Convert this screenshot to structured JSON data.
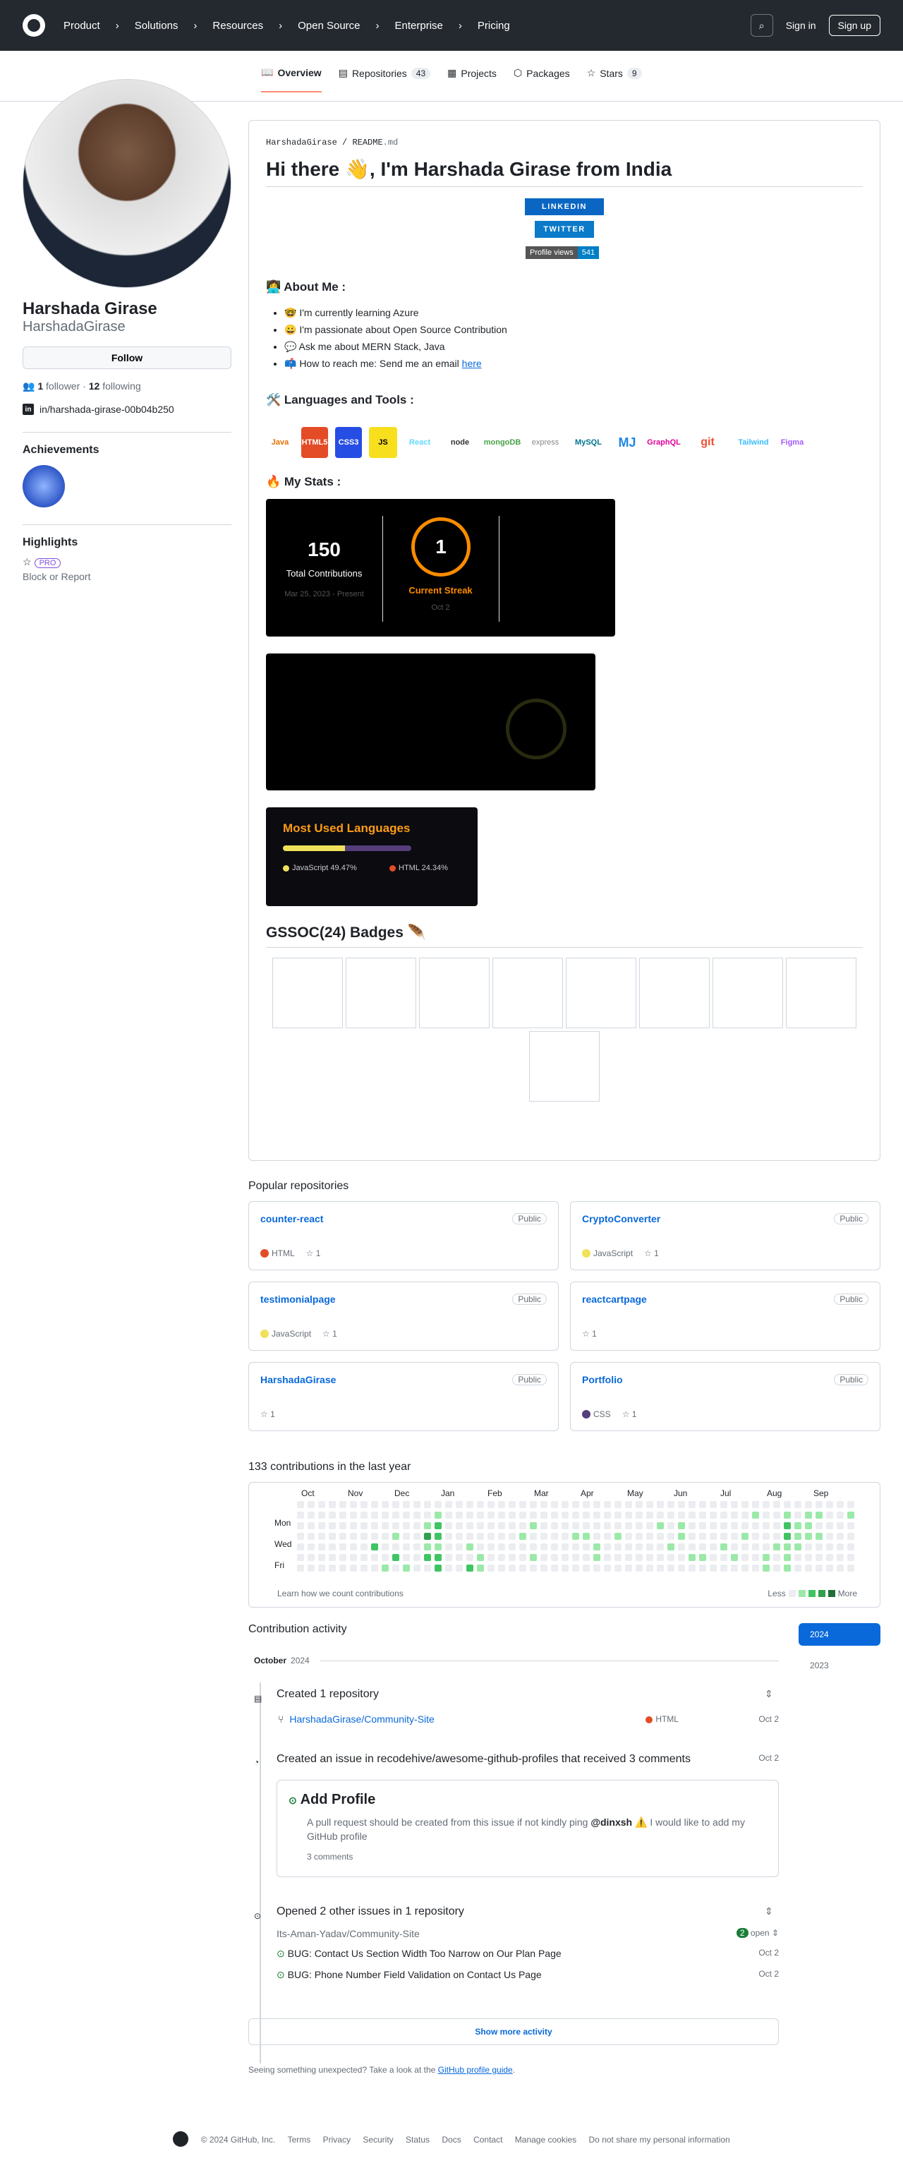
{
  "header": {
    "nav": [
      "Product",
      "Solutions",
      "Resources",
      "Open Source",
      "Enterprise",
      "Pricing"
    ],
    "sign_in": "Sign in",
    "sign_up": "Sign up"
  },
  "tabs": [
    {
      "label": "Overview"
    },
    {
      "label": "Repositories",
      "count": "43"
    },
    {
      "label": "Projects"
    },
    {
      "label": "Packages"
    },
    {
      "label": "Stars",
      "count": "9"
    }
  ],
  "profile": {
    "name": "Harshada Girase",
    "login": "HarshadaGirase",
    "follow": "Follow",
    "followers": "1",
    "followers_label": "follower",
    "following": "12",
    "following_label": "following",
    "linkedin": "in/harshada-girase-00b04b250",
    "achievements_title": "Achievements",
    "highlights_title": "Highlights",
    "pro": "PRO",
    "block": "Block or Report"
  },
  "readme": {
    "crumb_user": "HarshadaGirase",
    "crumb_file": "README",
    "crumb_ext": ".md",
    "title": "Hi there 👋, I'm Harshada Girase from India",
    "linkedin_badge": "LINKEDIN",
    "twitter_badge": "TWITTER",
    "views_label": "Profile views",
    "views": "541",
    "about_title": "👩‍💻 About Me :",
    "about": [
      "🤓 I'm currently learning Azure",
      "😀 I'm passionate about Open Source Contribution",
      "💬 Ask me about MERN Stack, Java",
      "📫 How to reach me: Send me an email "
    ],
    "here": "here",
    "tools_title": "🛠️ Languages and Tools :",
    "tools": [
      "Java",
      "HTML5",
      "CSS3",
      "JS",
      "React",
      "node",
      "mongoDB",
      "express",
      "MySQL",
      "MJ",
      "GraphQL",
      "git",
      "Tailwind",
      "Figma"
    ],
    "stats_title": "🔥 My Stats :",
    "streak": {
      "total": "150",
      "total_label": "Total Contributions",
      "total_range": "Mar 25, 2023 - Present",
      "current": "1",
      "current_label": "Current Streak",
      "current_date": "Oct 2"
    },
    "langs_title": "Most Used Languages",
    "langs": [
      {
        "name": "JavaScript",
        "pct": "49.47%",
        "color": "#f1e05a",
        "v": 49.47
      },
      {
        "name": "HTML",
        "pct": "24.34%",
        "color": "#e34c26",
        "v": 24.34
      }
    ],
    "gssoc_title": "GSSOC(24) Badges 🪶"
  },
  "popular": {
    "title": "Popular repositories",
    "public": "Public",
    "repos": [
      {
        "name": "counter-react",
        "lang": "HTML",
        "color": "#e34c26",
        "stars": "1"
      },
      {
        "name": "CryptoConverter",
        "lang": "JavaScript",
        "color": "#f1e05a",
        "stars": "1"
      },
      {
        "name": "testimonialpage",
        "lang": "JavaScript",
        "color": "#f1e05a",
        "stars": "1"
      },
      {
        "name": "reactcartpage",
        "lang": "",
        "color": "",
        "stars": "1"
      },
      {
        "name": "HarshadaGirase",
        "lang": "",
        "color": "",
        "stars": "1"
      },
      {
        "name": "Portfolio",
        "lang": "CSS",
        "color": "#563d7c",
        "stars": "1"
      }
    ]
  },
  "contrib": {
    "title": "133 contributions in the last year",
    "months": [
      "Oct",
      "Nov",
      "Dec",
      "Jan",
      "Feb",
      "Mar",
      "Apr",
      "May",
      "Jun",
      "Jul",
      "Aug",
      "Sep"
    ],
    "days": [
      "Mon",
      "Wed",
      "Fri"
    ],
    "learn": "Learn how we count contributions",
    "less": "Less",
    "more": "More"
  },
  "activity": {
    "title": "Contribution activity",
    "years": [
      "2024",
      "2023"
    ],
    "month": "October",
    "month_year": "2024",
    "created_repo": "Created 1 repository",
    "repo": "HarshadaGirase/Community-Site",
    "repo_lang": "HTML",
    "repo_date": "Oct 2",
    "issue_head": "Created an issue in recodehive/awesome-github-profiles that received 3 comments",
    "issue_date": "Oct 2",
    "issue_title": "Add Profile",
    "issue_body_1": "A pull request should be created from this issue if not kindly ping ",
    "issue_mention": "@dinxsh",
    "issue_body_2": " ⚠️ I would like to add my GitHub profile",
    "issue_comments": "3 comments",
    "other_head": "Opened 2 other issues in 1 repository",
    "other_repo": "Its-Aman-Yadav/Community-Site",
    "other_open_count": "2",
    "other_open": "open",
    "issues": [
      {
        "t": "BUG: Contact Us Section Width Too Narrow on Our Plan Page",
        "d": "Oct 2"
      },
      {
        "t": "BUG: Phone Number Field Validation on Contact Us Page",
        "d": "Oct 2"
      }
    ],
    "show_more": "Show more activity",
    "unexpected": "Seeing something unexpected? Take a look at the ",
    "guide": "GitHub profile guide",
    "period": "."
  },
  "footer": [
    "© 2024 GitHub, Inc.",
    "Terms",
    "Privacy",
    "Security",
    "Status",
    "Docs",
    "Contact",
    "Manage cookies",
    "Do not share my personal information"
  ]
}
